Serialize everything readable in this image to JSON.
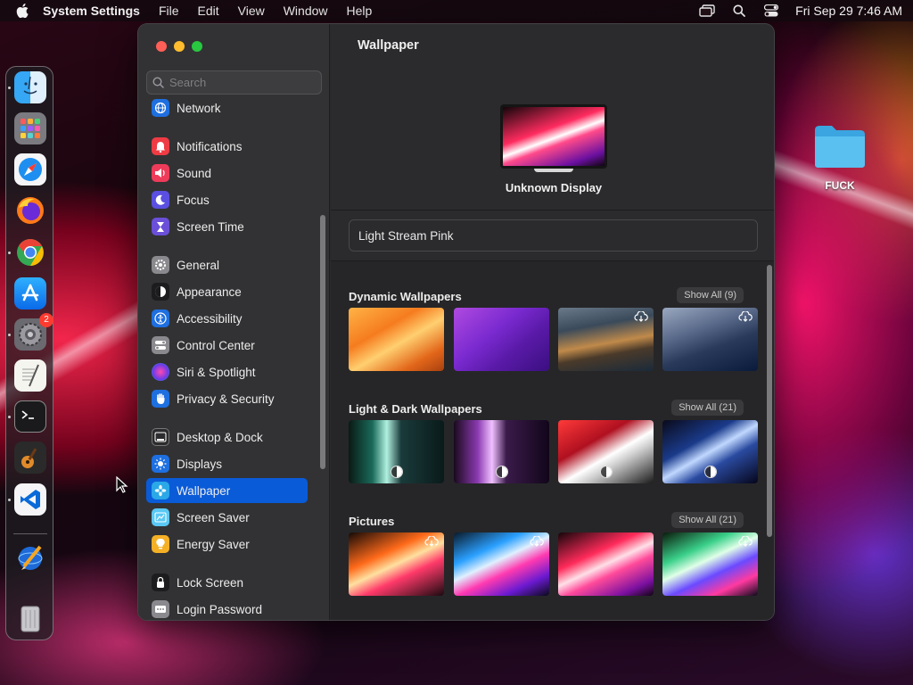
{
  "menubar": {
    "app_name": "System Settings",
    "menus": [
      "File",
      "Edit",
      "View",
      "Window",
      "Help"
    ],
    "clock": "Fri Sep 29  7:46 AM"
  },
  "dock": {
    "apps": [
      {
        "name": "finder",
        "running": true
      },
      {
        "name": "launchpad",
        "running": false
      },
      {
        "name": "safari",
        "running": false
      },
      {
        "name": "firefox",
        "running": false
      },
      {
        "name": "chrome",
        "running": true
      },
      {
        "name": "app-store",
        "running": false
      },
      {
        "name": "system-settings",
        "running": true,
        "badge": "2"
      },
      {
        "name": "textedit",
        "running": false
      },
      {
        "name": "terminal",
        "running": true
      },
      {
        "name": "garageband",
        "running": false
      },
      {
        "name": "vscode",
        "running": true
      },
      {
        "name": "sketch-pencil",
        "running": false
      },
      {
        "name": "trash",
        "running": false
      }
    ]
  },
  "desktop": {
    "folder_label": "FUCK"
  },
  "sidebar": {
    "search_placeholder": "Search",
    "items": [
      {
        "label": "Network",
        "icon": "globe-icon",
        "color": "#1e6fe0"
      },
      {
        "label": "Notifications",
        "icon": "bell-icon",
        "color": "#ee3b44"
      },
      {
        "label": "Sound",
        "icon": "speaker-icon",
        "color": "#ee3b5a"
      },
      {
        "label": "Focus",
        "icon": "moon-icon",
        "color": "#5a4fe0"
      },
      {
        "label": "Screen Time",
        "icon": "hourglass-icon",
        "color": "#6a4fd8"
      },
      {
        "label": "General",
        "icon": "gear-icon",
        "color": "#8a8a8e"
      },
      {
        "label": "Appearance",
        "icon": "appearance-icon",
        "color": "#1c1c1e"
      },
      {
        "label": "Accessibility",
        "icon": "accessibility-icon",
        "color": "#1e6fe0"
      },
      {
        "label": "Control Center",
        "icon": "toggles-icon",
        "color": "#8a8a8e"
      },
      {
        "label": "Siri & Spotlight",
        "icon": "siri-icon",
        "color": "#b03ad8"
      },
      {
        "label": "Privacy & Security",
        "icon": "hand-icon",
        "color": "#1e6fe0"
      },
      {
        "label": "Desktop & Dock",
        "icon": "dock-icon",
        "color": "#2c2c2e"
      },
      {
        "label": "Displays",
        "icon": "sun-icon",
        "color": "#1e6fe0"
      },
      {
        "label": "Wallpaper",
        "icon": "flower-icon",
        "color": "#2aa8e8",
        "selected": true
      },
      {
        "label": "Screen Saver",
        "icon": "screensaver-icon",
        "color": "#5ac8f5"
      },
      {
        "label": "Energy Saver",
        "icon": "lightbulb-icon",
        "color": "#f5b026"
      },
      {
        "label": "Lock Screen",
        "icon": "lock-icon",
        "color": "#1c1c1e"
      },
      {
        "label": "Login Password",
        "icon": "password-icon",
        "color": "#8a8a8e"
      }
    ]
  },
  "content": {
    "title": "Wallpaper",
    "display_name": "Unknown Display",
    "current_wallpaper": "Light Stream Pink",
    "sections": [
      {
        "title": "Dynamic Wallpapers",
        "show_all": "Show All (9)"
      },
      {
        "title": "Light & Dark Wallpapers",
        "show_all": "Show All (21)"
      },
      {
        "title": "Pictures",
        "show_all": "Show All (21)"
      }
    ]
  }
}
